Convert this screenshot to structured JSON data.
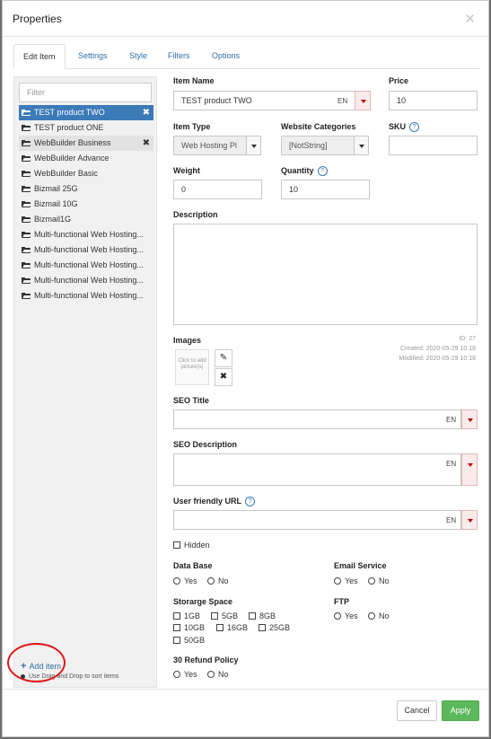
{
  "dialog": {
    "title": "Properties"
  },
  "tabs": [
    "Edit Item",
    "Settings",
    "Style",
    "Filters",
    "Options"
  ],
  "left": {
    "filter_placeholder": "Filter",
    "items": [
      "TEST product TWO",
      "TEST product ONE",
      "WebBuilder Business",
      "WebBuilder Advance",
      "WebBuilder Basic",
      "Bizmail 25G",
      "Bizmail 10G",
      "Bizmail1G",
      "Multi-functional Web Hosting...",
      "Multi-functional Web Hosting...",
      "Multi-functional Web Hosting...",
      "Multi-functional Web Hosting...",
      "Multi-functional Web Hosting..."
    ],
    "add_item": "Add item",
    "dnd_hint": "Use Drag and Drop to sort items"
  },
  "form": {
    "item_name_label": "Item Name",
    "item_name_value": "TEST product TWO",
    "lang": "EN",
    "price_label": "Price",
    "price_value": "10",
    "item_type_label": "Item Type",
    "item_type_value": "Web Hosting Pl",
    "website_categories_label": "Website Categories",
    "website_categories_value": "[NotString]",
    "sku_label": "SKU",
    "sku_value": "",
    "weight_label": "Weight",
    "weight_value": "0",
    "quantity_label": "Quantity",
    "quantity_value": "10",
    "description_label": "Description",
    "images_label": "Images",
    "image_placeholder": "Click to add picture(s)",
    "id_text": "ID: 27",
    "created_text": "Created: 2020-05-29 10:18",
    "modified_text": "Modified: 2020-05-29 10:18",
    "seo_title_label": "SEO Title",
    "seo_description_label": "SEO Description",
    "friendly_url_label": "User friendly URL",
    "hidden_label": "Hidden",
    "database_label": "Data Base",
    "email_service_label": "Email Service",
    "yes": "Yes",
    "no": "No",
    "storage_label": "Storarge Space",
    "storage_options": [
      "1GB",
      "5GB",
      "8GB",
      "10GB",
      "16GB",
      "25GB",
      "50GB"
    ],
    "ftp_label": "FTP",
    "refund_label": "30 Refund Policy",
    "help_glyph": "?"
  },
  "footer": {
    "cancel": "Cancel",
    "apply": "Apply"
  },
  "colors": {
    "accent": "#3c7ab8",
    "apply": "#5cb85c",
    "annotation": "#e01818"
  }
}
